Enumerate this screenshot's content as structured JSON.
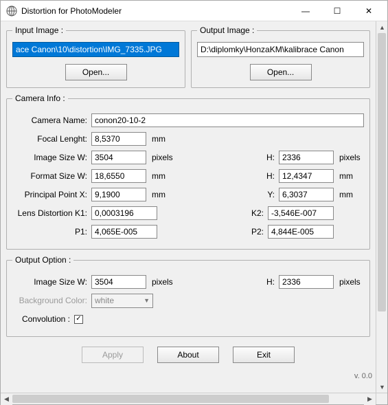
{
  "window": {
    "title": "Distortion for PhotoModeler",
    "minimize_glyph": "—",
    "maximize_glyph": "☐",
    "close_glyph": "✕"
  },
  "input_image": {
    "legend": "Input Image :",
    "path": "ace Canon\\10\\distortion\\IMG_7335.JPG",
    "open_label": "Open..."
  },
  "output_image": {
    "legend": "Output Image :",
    "path": "D:\\diplomky\\HonzaKM\\kalibrace Canon",
    "open_label": "Open..."
  },
  "camera": {
    "legend": "Camera Info :",
    "name_label": "Camera Name:",
    "name_value": "conon20-10-2",
    "focal_label": "Focal Lenght:",
    "focal_value": "8,5370",
    "focal_unit": "mm",
    "imgw_label": "Image Size  W:",
    "imgw_value": "3504",
    "imgw_unit": "pixels",
    "imgh_label": "H:",
    "imgh_value": "2336",
    "imgh_unit": "pixels",
    "fmtw_label": "Format Size  W:",
    "fmtw_value": "18,6550",
    "fmtw_unit": "mm",
    "fmth_label": "H:",
    "fmth_value": "12,4347",
    "fmth_unit": "mm",
    "ppx_label": "Principal Point  X:",
    "ppx_value": "9,1900",
    "ppx_unit": "mm",
    "ppy_label": "Y:",
    "ppy_value": "6,3037",
    "ppy_unit": "mm",
    "k1_label": "Lens Distortion  K1:",
    "k1_value": "0,0003196",
    "k2_label": "K2:",
    "k2_value": "-3,546E-007",
    "p1_label": "P1:",
    "p1_value": "4,065E-005",
    "p2_label": "P2:",
    "p2_value": "4,844E-005"
  },
  "output_option": {
    "legend": "Output Option :",
    "imgw_label": "Image Size  W:",
    "imgw_value": "3504",
    "imgw_unit": "pixels",
    "imgh_label": "H:",
    "imgh_value": "2336",
    "imgh_unit": "pixels",
    "bg_label": "Background Color:",
    "bg_value": "white",
    "conv_label": "Convolution :",
    "conv_checked": "✓"
  },
  "buttons": {
    "apply": "Apply",
    "about": "About",
    "exit": "Exit"
  },
  "version": "v. 0.0"
}
